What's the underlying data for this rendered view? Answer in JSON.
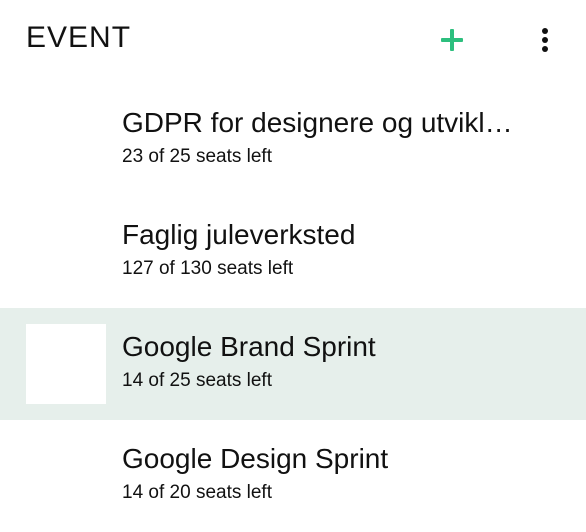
{
  "header": {
    "logo_text": "EVENT",
    "add_icon": "plus-icon",
    "more_icon": "more-vertical-icon",
    "accent_color": "#2dbf7e"
  },
  "events": [
    {
      "title": "GDPR for designere og utvikl…",
      "seats": "23 of 25 seats left",
      "selected": false
    },
    {
      "title": "Faglig juleverksted",
      "seats": "127 of 130 seats left",
      "selected": false
    },
    {
      "title": "Google Brand Sprint",
      "seats": "14 of 25 seats left",
      "selected": true
    },
    {
      "title": "Google Design Sprint",
      "seats": "14 of 20 seats left",
      "selected": false
    }
  ],
  "colors": {
    "selected_row_background": "#e6efeb"
  }
}
